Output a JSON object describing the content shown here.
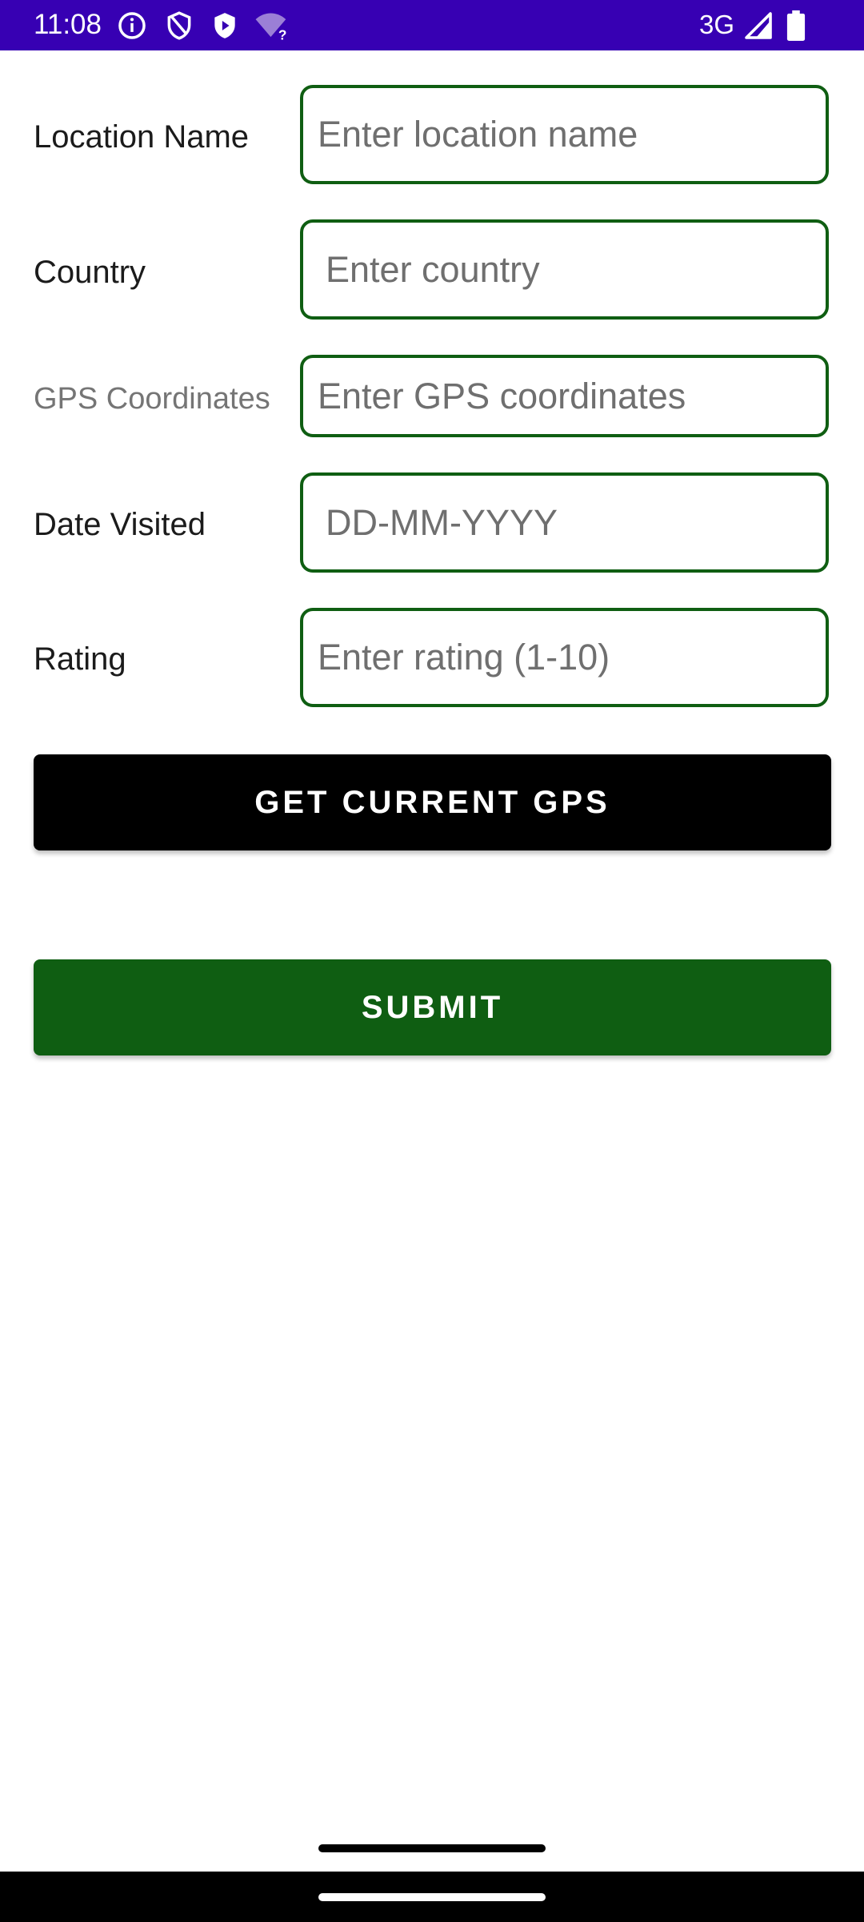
{
  "status_bar": {
    "time": "11:08",
    "network": "3G",
    "background_color": "#3700b3",
    "icons": [
      "info-icon",
      "privacy-shield-icon",
      "play-protect-icon",
      "wifi-unknown-icon",
      "cell-signal-icon",
      "battery-icon"
    ]
  },
  "form": {
    "location_name": {
      "label": "Location Name",
      "placeholder": "Enter location name",
      "value": ""
    },
    "country": {
      "label": "Country",
      "placeholder": "Enter country",
      "value": ""
    },
    "gps": {
      "label": "GPS Coordinates",
      "placeholder": "Enter GPS coordinates",
      "value": ""
    },
    "date_visited": {
      "label": "Date Visited",
      "placeholder": "DD-MM-YYYY",
      "value": ""
    },
    "rating": {
      "label": "Rating",
      "placeholder": "Enter rating (1-10)",
      "value": ""
    }
  },
  "buttons": {
    "get_gps_label": "GET CURRENT GPS",
    "submit_label": "SUBMIT"
  },
  "colors": {
    "accent_green": "#0f5e12",
    "field_border": "#0f5e12",
    "gps_button": "#000000",
    "status_bar": "#3700b3"
  }
}
